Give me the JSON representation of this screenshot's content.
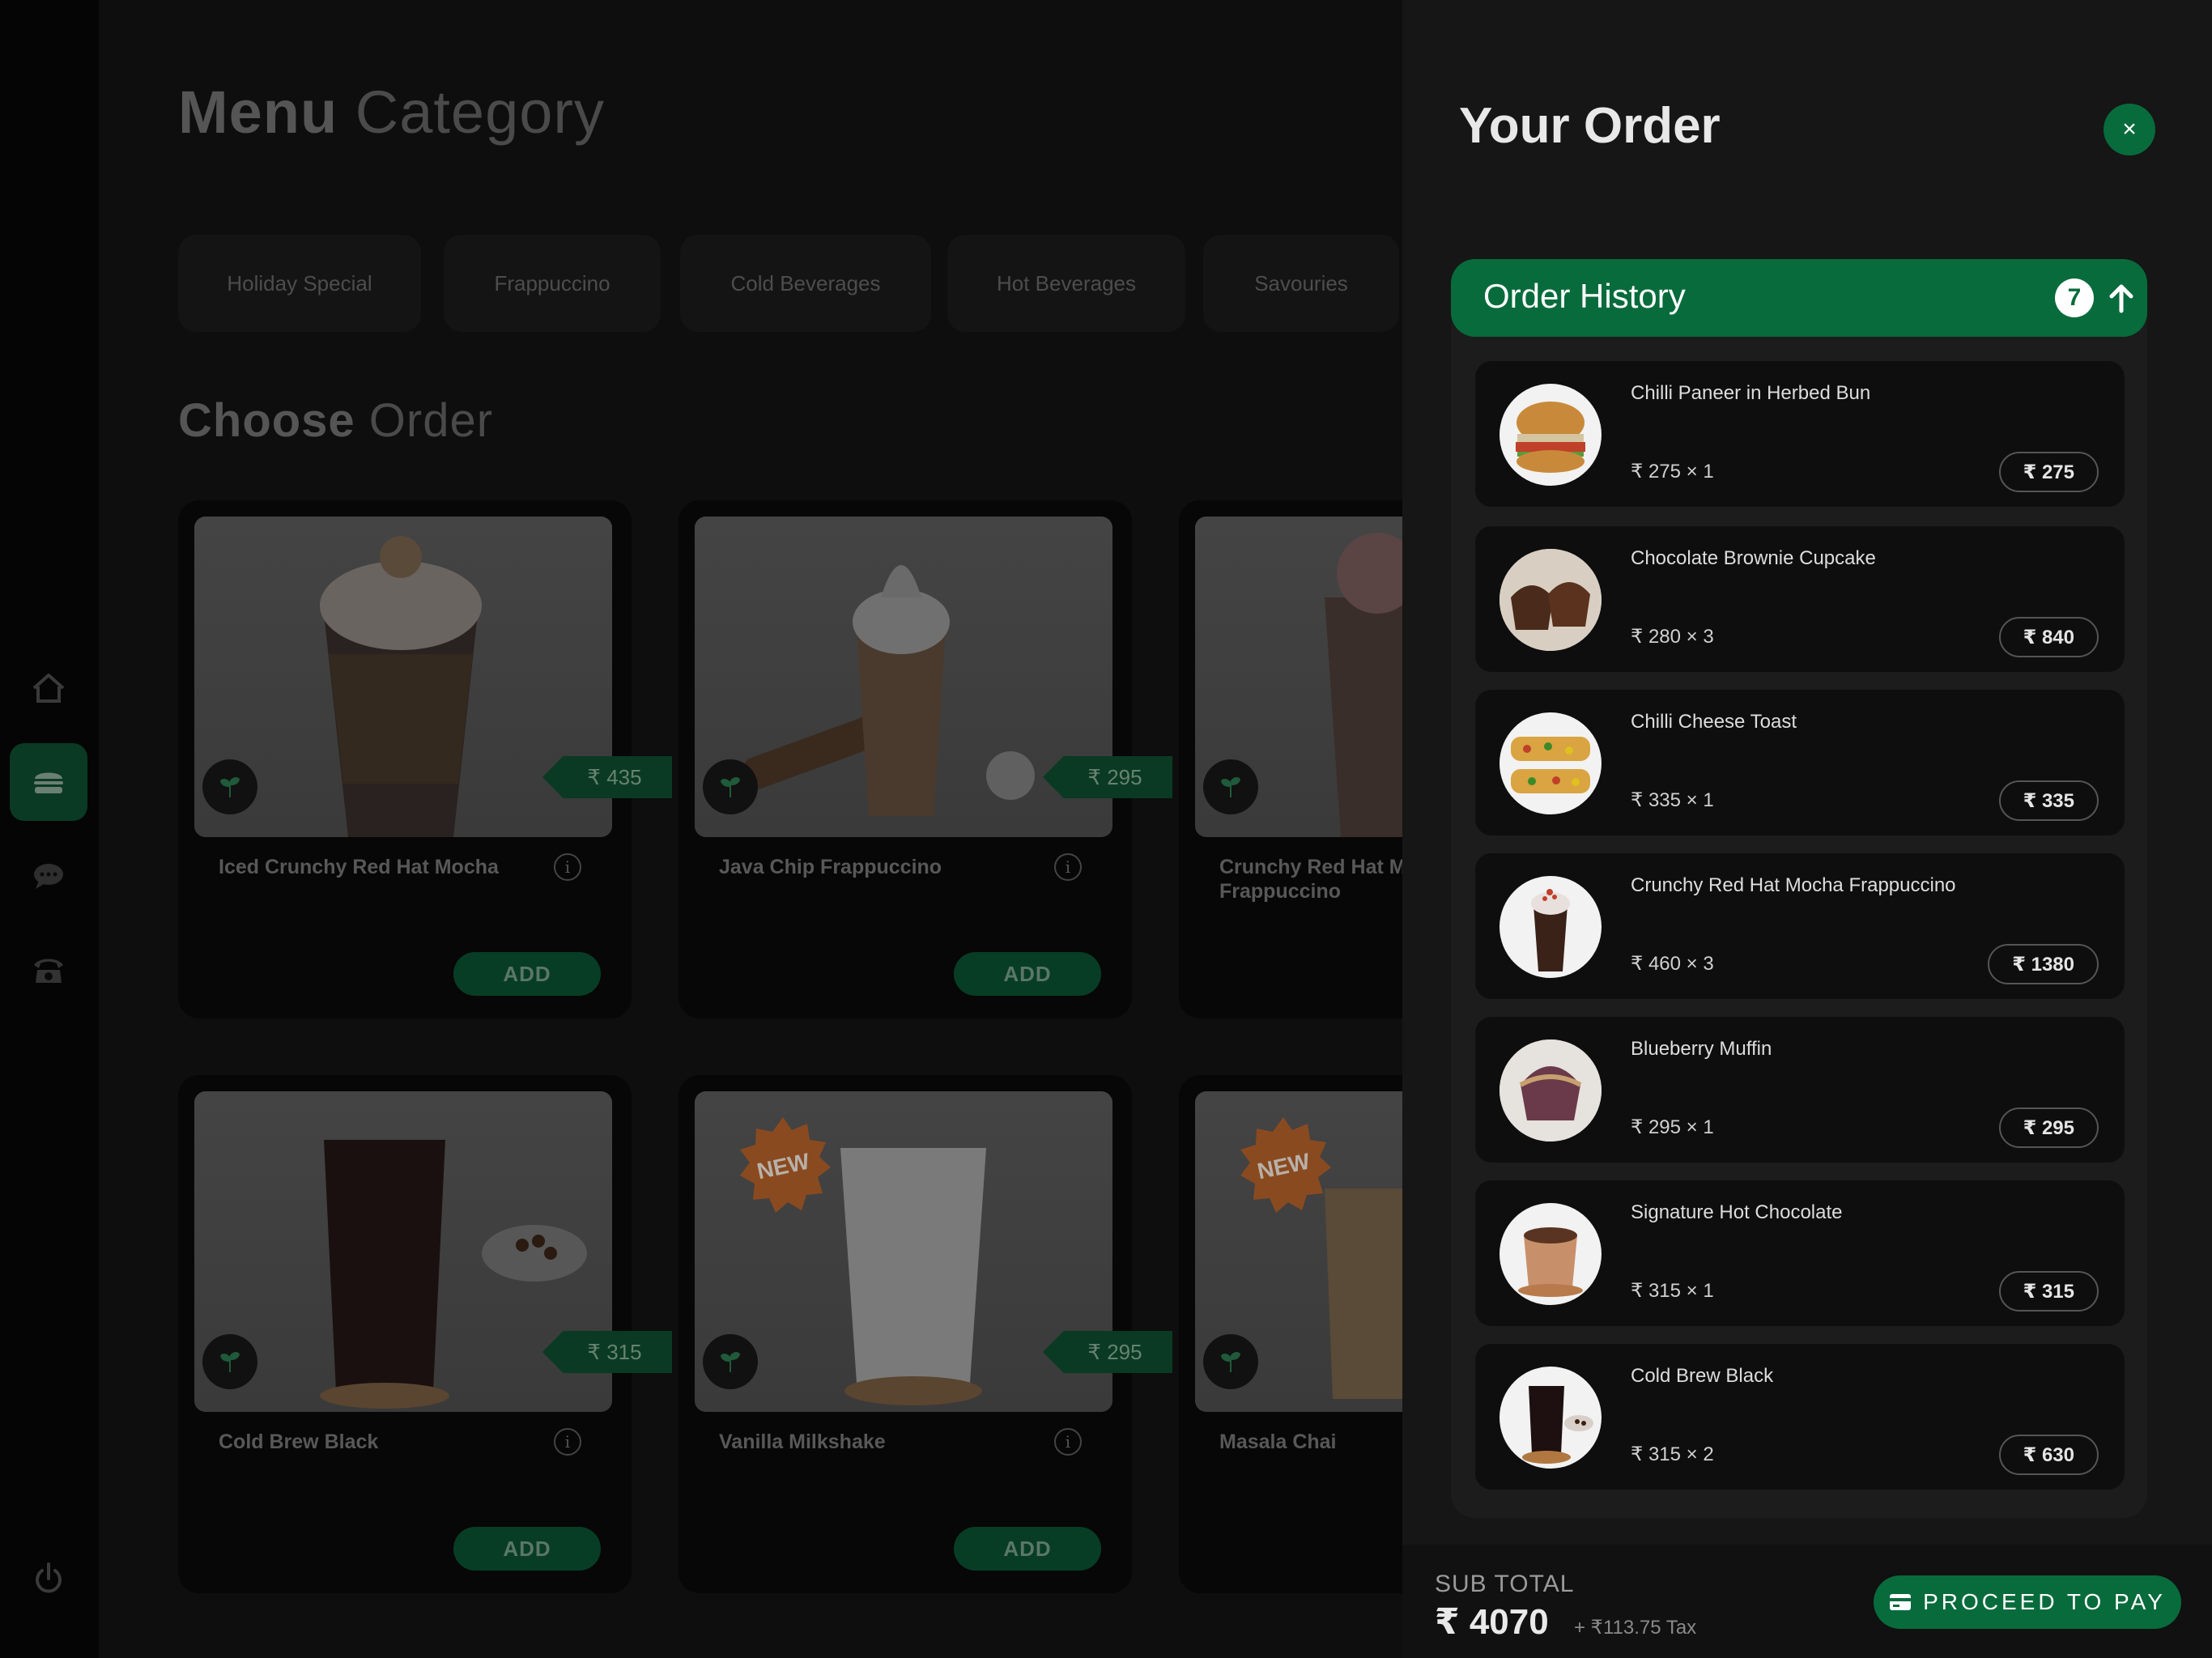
{
  "colors": {
    "accent": "#086b3c",
    "accent_dim": "#0a3a24",
    "panel_bg": "#161616",
    "page_bg": "#0e0e0e"
  },
  "sidebar": {
    "items": [
      {
        "icon": "home-icon",
        "active": false
      },
      {
        "icon": "burger-icon",
        "active": true
      },
      {
        "icon": "chat-icon",
        "active": false
      },
      {
        "icon": "phone-icon",
        "active": false
      },
      {
        "icon": "power-icon",
        "active": false
      }
    ]
  },
  "main": {
    "menu_heading": {
      "bold": "Menu",
      "light": " Category"
    },
    "categories": [
      "Holiday Special",
      "Frappuccino",
      "Cold Beverages",
      "Hot Beverages",
      "Savouries"
    ],
    "choose_heading": {
      "bold": "Choose",
      "light": " Order"
    },
    "products": [
      {
        "name": "Iced Crunchy Red Hat Mocha",
        "price": "₹ 435",
        "add_label": "ADD",
        "is_new": false
      },
      {
        "name": "Java Chip Frappuccino",
        "price": "₹ 295",
        "add_label": "ADD",
        "is_new": false
      },
      {
        "name": "Crunchy Red Hat Mocha Frappuccino",
        "price": "",
        "add_label": "",
        "is_new": false
      },
      {
        "name": "Cold Brew Black",
        "price": "₹ 315",
        "add_label": "ADD",
        "is_new": false
      },
      {
        "name": "Vanilla Milkshake",
        "price": "₹ 295",
        "add_label": "ADD",
        "is_new": true
      },
      {
        "name": "Masala Chai",
        "price": "",
        "add_label": "",
        "is_new": true
      }
    ],
    "new_badge_label": "NEW",
    "info_glyph": "i"
  },
  "panel": {
    "title_bold": "Your",
    "title_light": " Order",
    "close_glyph": "×",
    "history": {
      "title": "Order History",
      "count": "7",
      "items": [
        {
          "name": "Chilli Paneer in Herbed Bun",
          "qty": "₹ 275 × 1",
          "total": "₹ 275"
        },
        {
          "name": "Chocolate Brownie Cupcake",
          "qty": "₹ 280 × 3",
          "total": "₹ 840"
        },
        {
          "name": "Chilli Cheese Toast",
          "qty": "₹ 335 × 1",
          "total": "₹ 335"
        },
        {
          "name": "Crunchy Red Hat Mocha Frappuccino",
          "qty": "₹ 460 × 3",
          "total": "₹ 1380"
        },
        {
          "name": "Blueberry Muffin",
          "qty": "₹ 295 × 1",
          "total": "₹ 295"
        },
        {
          "name": "Signature Hot Chocolate",
          "qty": "₹ 315 × 1",
          "total": "₹ 315"
        },
        {
          "name": "Cold Brew Black",
          "qty": "₹ 315 × 2",
          "total": "₹ 630"
        }
      ]
    },
    "footer": {
      "subtotal_label": "SUB TOTAL",
      "subtotal_amount": "₹ 4070",
      "tax": "+ ₹113.75 Tax",
      "pay_label": "PROCEED TO PAY"
    }
  }
}
